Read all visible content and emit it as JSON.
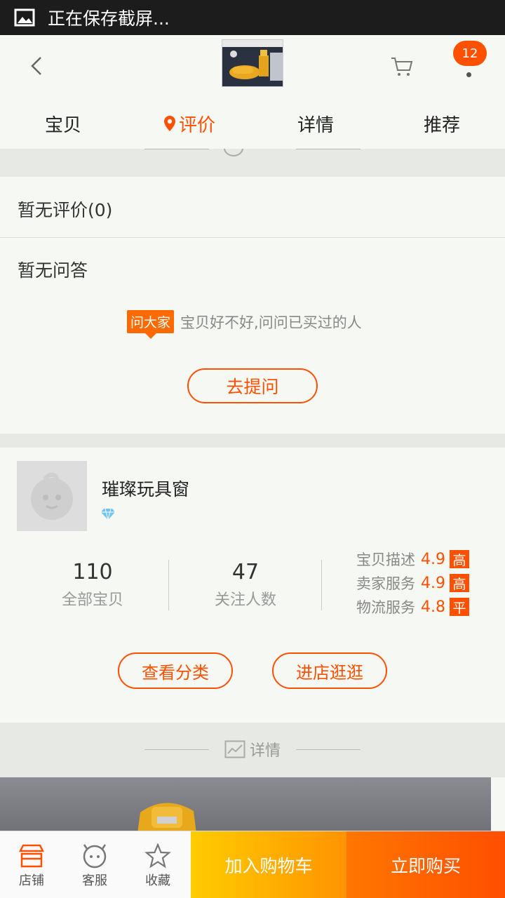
{
  "status_bar": {
    "text": "正在保存截屏..."
  },
  "header": {
    "cart_badge": "12"
  },
  "tabs": [
    {
      "label": "宝贝"
    },
    {
      "label": "评价"
    },
    {
      "label": "详情"
    },
    {
      "label": "推荐"
    }
  ],
  "reviews": {
    "no_reviews": "暂无评价(0)",
    "no_qa": "暂无问答",
    "ask_tag": "问大家",
    "ask_hint": "宝贝好不好,问问已买过的人",
    "ask_button": "去提问"
  },
  "shop": {
    "name": "璀璨玩具窗",
    "stats": [
      {
        "value": "110",
        "label": "全部宝贝"
      },
      {
        "value": "47",
        "label": "关注人数"
      }
    ],
    "ratings": [
      {
        "label": "宝贝描述",
        "score": "4.9",
        "tag": "高"
      },
      {
        "label": "卖家服务",
        "score": "4.9",
        "tag": "高"
      },
      {
        "label": "物流服务",
        "score": "4.8",
        "tag": "平"
      }
    ],
    "view_categories": "查看分类",
    "visit_shop": "进店逛逛"
  },
  "detail_section": {
    "label": "详情"
  },
  "bottom_bar": {
    "shop": "店铺",
    "service": "客服",
    "favorite": "收藏",
    "add_to_cart": "加入购物车",
    "buy_now": "立即购买"
  },
  "colors": {
    "accent": "#ff5000",
    "cart_gradient": [
      "#ffcc00",
      "#ff9402"
    ],
    "buy_gradient": [
      "#ff7700",
      "#ff4e00"
    ]
  }
}
